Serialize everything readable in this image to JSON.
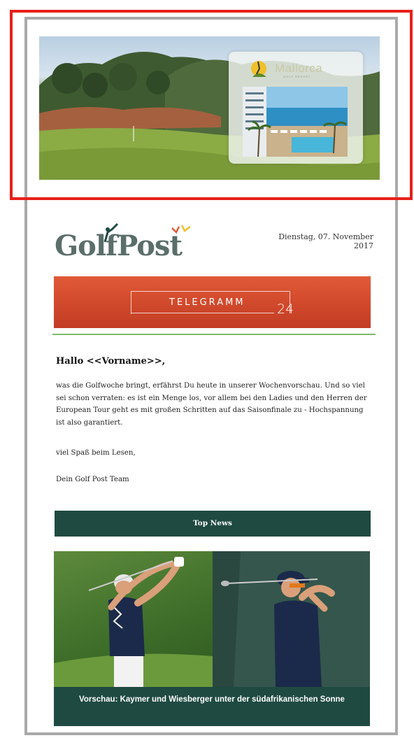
{
  "ad": {
    "brand": "Mallorca",
    "brand_sub": "GOLF RESORT"
  },
  "header": {
    "logo_text": "GolfPost",
    "date": "Dienstag, 07. November 2017"
  },
  "telegram": {
    "label": "TELEGRAMM",
    "number": "24"
  },
  "content": {
    "greeting": "Hallo <<Vorname>>,",
    "body": "was die Golfwoche bringt, erfährst Du heute in unserer Wochenvorschau. Und so viel sei schon verraten: es ist ein Menge los, vor allem bei den Ladies und den Herren der European Tour geht es mit großen Schritten auf das Saisonfinale zu - Hochspannung ist also garantiert.",
    "closing": "viel Spaß beim Lesen,",
    "signature": "Dein Golf Post Team"
  },
  "section": {
    "top_news": "Top News"
  },
  "news": {
    "caption": "Vorschau: Kaymer und Wiesberger unter der südafrikanischen Sonne"
  },
  "colors": {
    "accent_red": "#d24a2c",
    "dark_green": "#1f4a41",
    "divider_green": "#7fbb66",
    "highlight_outline": "#e8201b"
  }
}
